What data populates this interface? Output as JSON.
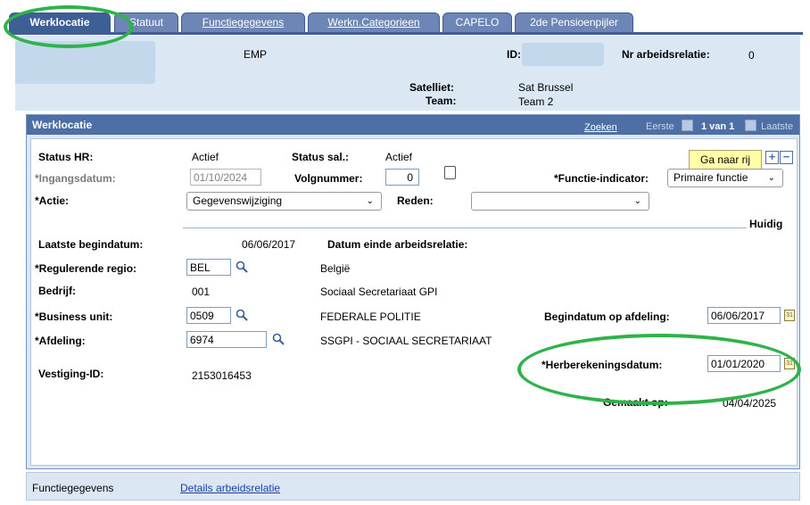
{
  "tabs": [
    {
      "label": "Werklocatie",
      "active": true
    },
    {
      "label": "Statuut",
      "active": false
    },
    {
      "label": "Functiegegevens",
      "active": false
    },
    {
      "label": "Werkn.Categorieen",
      "active": false
    },
    {
      "label": "CAPELO",
      "active": false
    },
    {
      "label": "2de Pensioenpijler",
      "active": false
    }
  ],
  "header": {
    "emp": "EMP",
    "id_label": "ID:",
    "nr_label": "Nr arbeidsrelatie:",
    "nr_value": "0",
    "satelliet_label": "Satelliet:",
    "satelliet_value": "Sat Brussel",
    "team_label": "Team:",
    "team_value": "Team 2"
  },
  "panel": {
    "title": "Werklocatie",
    "zoeken": "Zoeken",
    "eerste": "Eerste",
    "van": "1 van 1",
    "laatste": "Laatste",
    "ga_naar_rij": "Ga naar rij",
    "plus": "+",
    "minus": "−"
  },
  "form": {
    "status_hr_label": "Status HR:",
    "status_hr_value": "Actief",
    "status_sal_label": "Status sal.:",
    "status_sal_value": "Actief",
    "ingangsdatum_label": "*Ingangsdatum:",
    "ingangsdatum_value": "01/10/2024",
    "volgnummer_label": "Volgnummer:",
    "volgnummer_value": "0",
    "functie_indicator_label": "*Functie-indicator:",
    "functie_indicator_value": "Primaire functie",
    "actie_label": "*Actie:",
    "actie_value": "Gegevenswijziging",
    "reden_label": "Reden:",
    "reden_value": "",
    "huidig": "Huidig",
    "laatste_begindatum_label": "Laatste begindatum:",
    "laatste_begindatum_value": "06/06/2017",
    "datum_einde_label": "Datum einde arbeidsrelatie:",
    "regio_label": "*Regulerende regio:",
    "regio_value": "BEL",
    "regio_desc": "België",
    "bedrijf_label": "Bedrijf:",
    "bedrijf_value": "001",
    "bedrijf_desc": "Sociaal Secretariaat GPI",
    "bu_label": "*Business unit:",
    "bu_value": "0509",
    "bu_desc": "FEDERALE POLITIE",
    "begindatum_afdeling_label": "Begindatum op afdeling:",
    "begindatum_afdeling_value": "06/06/2017",
    "afdeling_label": "*Afdeling:",
    "afdeling_value": "6974",
    "afdeling_desc": "SSGPI - SOCIAAL SECRETARIAAT",
    "herber_label": "*Herberekeningsdatum:",
    "herber_value": "01/01/2020",
    "vestiging_label": "Vestiging-ID:",
    "vestiging_value": "2153016453",
    "gemaakt_label": "Gemaakt op:",
    "gemaakt_value": "04/04/2025"
  },
  "footer": {
    "functiegegevens": "Functiegegevens",
    "details_link": "Details arbeidsrelatie"
  },
  "colors": {
    "tab_bg": "#6d86b5",
    "tab_active": "#3e5e96",
    "panel_header": "#4e6ea6",
    "header_band": "#dbe8f3",
    "annotation": "#2db34a"
  }
}
